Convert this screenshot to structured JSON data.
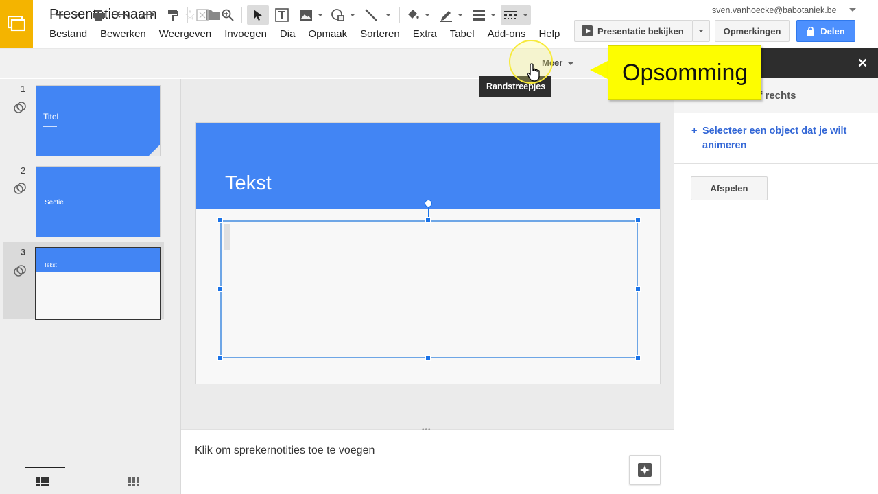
{
  "app": {
    "doc_title": "Presentatie naam",
    "account": "sven.vanhoecke@babotaniek.be"
  },
  "menu": [
    "Bestand",
    "Bewerken",
    "Weergeven",
    "Invoegen",
    "Dia",
    "Opmaak",
    "Sorteren",
    "Extra",
    "Tabel",
    "Add-ons",
    "Help"
  ],
  "actions": {
    "present_label": "Presentatie bekijken",
    "comments_label": "Opmerkingen",
    "share_label": "Delen"
  },
  "toolbar": {
    "more_label": "Meer",
    "tooltip": "Randstreepjes"
  },
  "callout": {
    "text": "Opsomming"
  },
  "slides": [
    {
      "num": "1",
      "title": "Titel"
    },
    {
      "num": "2",
      "title": "Sectie"
    },
    {
      "num": "3",
      "title": "Tekst"
    }
  ],
  "canvas": {
    "slide_title": "Tekst"
  },
  "notes": {
    "placeholder": "Klik om sprekernotities toe te voegen"
  },
  "panel": {
    "subtitle": "af rechts",
    "select_prompt": "Selecteer een object dat je wilt animeren",
    "play_label": "Afspelen"
  },
  "colors": {
    "brand": "#f4b400",
    "accent": "#4285f4",
    "share": "#4d90fe",
    "selection": "#1a73e8",
    "callout": "#fdfd00"
  }
}
